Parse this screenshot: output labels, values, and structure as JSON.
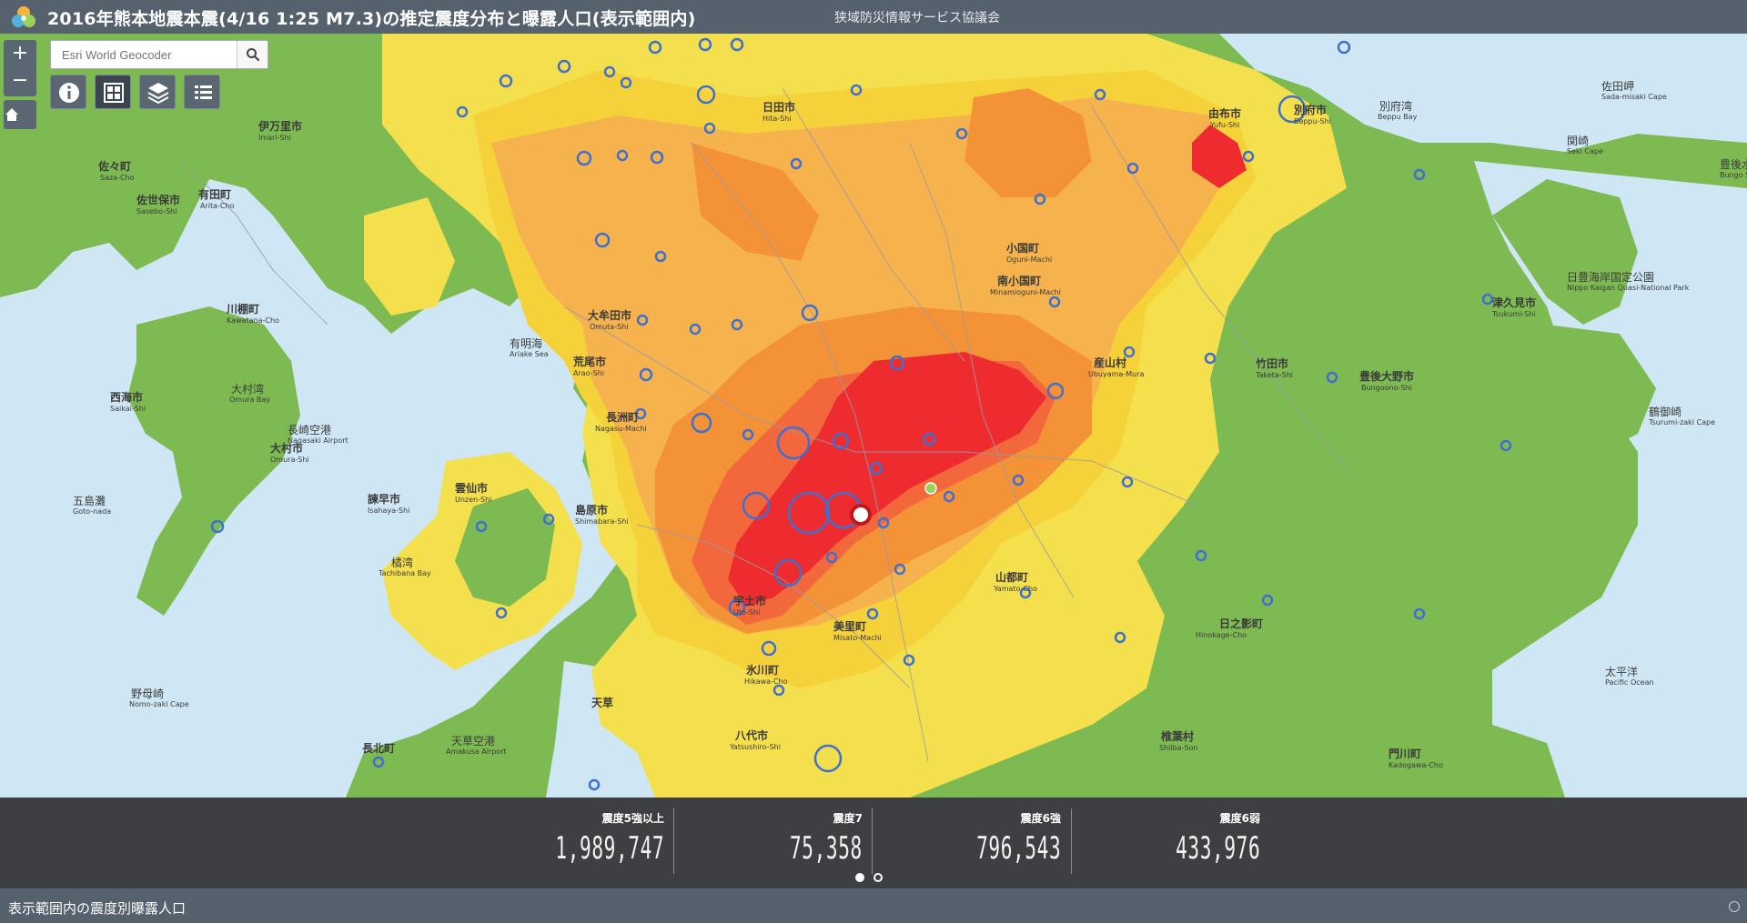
{
  "header": {
    "title": "2016年熊本地震本震(4/16 1:25 M7.3)の推定震度分布と曝露人口(表示範囲内)",
    "subtitle": "狭域防災情報サービス協議会"
  },
  "controls": {
    "zoom_in": "+",
    "zoom_out": "−",
    "search_placeholder": "Esri World Geocoder"
  },
  "map": {
    "intensity_colors": {
      "shindo_7": "#ee2c2f",
      "shindo_6_upper": "#f3673d",
      "shindo_6_lower": "#f49237",
      "shindo_5_upper": "#f6b24d",
      "shindo_5_lower": "#f6d23a",
      "shindo_4": "#f4e04c",
      "shindo_3": "#7dba52"
    },
    "labels": [
      {
        "text": "佐々町",
        "sub": "Saza-Cho"
      },
      {
        "text": "佐世保市",
        "sub": "Sasebo-Shi"
      },
      {
        "text": "有田町",
        "sub": "Arita-Cho"
      },
      {
        "text": "伊万里市",
        "sub": "Imari-Shi"
      },
      {
        "text": "川棚町",
        "sub": "Kawatana-Cho"
      },
      {
        "text": "大村市",
        "sub": "Omura-Shi"
      },
      {
        "text": "大村湾",
        "sub": "Omura Bay"
      },
      {
        "text": "西海市",
        "sub": "Saikai-Shi"
      },
      {
        "text": "五島灘",
        "sub": "Goto-nada"
      },
      {
        "text": "諫早市",
        "sub": "Isahaya-Shi"
      },
      {
        "text": "雲仙市",
        "sub": "Unzen-Shi"
      },
      {
        "text": "島原市",
        "sub": "Shimabara-Shi"
      },
      {
        "text": "橘湾",
        "sub": "Tachibana Bay"
      },
      {
        "text": "有明海",
        "sub": "Ariake Sea"
      },
      {
        "text": "大牟田市",
        "sub": "Omuta-Shi"
      },
      {
        "text": "荒尾市",
        "sub": "Arao-Shi"
      },
      {
        "text": "長洲町",
        "sub": "Nagasu-Machi"
      },
      {
        "text": "日田市",
        "sub": "Hita-Shi"
      },
      {
        "text": "小国町",
        "sub": "Oguni-Machi"
      },
      {
        "text": "南小国町",
        "sub": "Minamioguni-Machi"
      },
      {
        "text": "産山村",
        "sub": "Ubuyama-Mura"
      },
      {
        "text": "竹田市",
        "sub": "Taketa-Shi"
      },
      {
        "text": "由布市",
        "sub": "Yufu-Shi"
      },
      {
        "text": "別府市",
        "sub": "Beppu-Shi"
      },
      {
        "text": "別府湾",
        "sub": "Beppu Bay"
      },
      {
        "text": "佐田岬",
        "sub": "Sada-misaki Cape"
      },
      {
        "text": "関崎",
        "sub": "Seki Cape"
      },
      {
        "text": "豊後水道",
        "sub": "Bungo Strait"
      },
      {
        "text": "豊後大野市",
        "sub": "Bungoono-Shi"
      },
      {
        "text": "津久見市",
        "sub": "Tsukumi-Shi"
      },
      {
        "text": "日豊海岸国定公園",
        "sub": "Nippo Kaigan Quasi-National Park"
      },
      {
        "text": "鶴御崎",
        "sub": "Tsurumi-zaki Cape"
      },
      {
        "text": "山都町",
        "sub": "Yamato-Cho"
      },
      {
        "text": "美里町",
        "sub": "Misato-Machi"
      },
      {
        "text": "氷川町",
        "sub": "Hikawa-Cho"
      },
      {
        "text": "八代市",
        "sub": "Yatsushiro-Shi"
      },
      {
        "text": "宇土市",
        "sub": "Uto-Shi"
      },
      {
        "text": "天草",
        "sub": ""
      },
      {
        "text": "椎葉村",
        "sub": "Shiiba-Son"
      },
      {
        "text": "日之影町",
        "sub": "Hinokage-Cho"
      },
      {
        "text": "門川町",
        "sub": "Kadogawa-Cho"
      },
      {
        "text": "太平洋",
        "sub": "Pacific Ocean"
      },
      {
        "text": "野母崎",
        "sub": "Nomo-zaki Cape"
      },
      {
        "text": "長北町",
        "sub": ""
      },
      {
        "text": "天草空港",
        "sub": "Amakusa Airport"
      },
      {
        "text": "長崎空港",
        "sub": "Nagasaki Airport"
      }
    ]
  },
  "stats": [
    {
      "label": "震度5強以上",
      "value": "1,989,747"
    },
    {
      "label": "震度7",
      "value": "75,358"
    },
    {
      "label": "震度6強",
      "value": "796,543"
    },
    {
      "label": "震度6弱",
      "value": "433,976"
    }
  ],
  "footer": {
    "title": "表示範囲内の震度別曝露人口"
  }
}
